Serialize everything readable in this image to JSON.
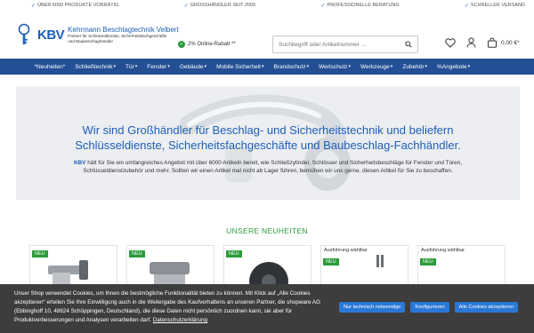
{
  "topbar": {
    "usps": [
      "ÜBER 6000 PRODUKTE VORRÄTIG",
      "GROSSHÄNDLER SEIT 2000",
      "PROFESSIONELLE BERATUNG",
      "SCHNELLER VERSAND"
    ]
  },
  "header": {
    "logo_mark": "KBV",
    "logo_title": "Kehrmann Beschlagtechnik Velbert",
    "logo_sub_line1": "Partner für Schlüsseldienste, Sicherheitsfachgeschäfte",
    "logo_sub_line2": "und Baubeschlaghändler",
    "rebate": "2% Online-Rabatt **",
    "search_placeholder": "Suchbegriff oder Artikelnummer ...",
    "cart_total": "0,00 €*"
  },
  "nav": {
    "items": [
      {
        "label": "*Neuheiten*",
        "chevron": false
      },
      {
        "label": "Schließtechnik",
        "chevron": true
      },
      {
        "label": "Tür",
        "chevron": true
      },
      {
        "label": "Fenster",
        "chevron": true
      },
      {
        "label": "Gebäude",
        "chevron": true
      },
      {
        "label": "Mobile Sicherheit",
        "chevron": true
      },
      {
        "label": "Brandschutz",
        "chevron": true
      },
      {
        "label": "Wertschutz",
        "chevron": true
      },
      {
        "label": "Werkzeuge",
        "chevron": true
      },
      {
        "label": "Zubehör",
        "chevron": true
      },
      {
        "label": "%Angebote",
        "chevron": true
      }
    ]
  },
  "hero": {
    "title_line1": "Wir sind Großhändler für Beschlag- und Sicherheitstechnik und beliefern",
    "title_line2": "Schlüsseldienste, Sicherheitsfachgeschäfte und Baubeschlag-Fachhändler.",
    "text_brand": "KBV",
    "text_line1": " hält für Sie ein umfangreiches Angebot mit über 6000 Artikeln bereit, wie Schließzylinder, Schlösser und Sicherheitsbeschläge für Fenster und Türen,",
    "text_line2": "Schlüsseldienstzubehör und mehr. Sollten wir einen Artikel mal nicht ab Lager führen, bemühen wir uns gerne, diesen Artikel für Sie zu beschaffen."
  },
  "news": {
    "title": "UNSERE NEUHEITEN",
    "cards": [
      {
        "badge": "NEU",
        "variant": ""
      },
      {
        "badge": "NEU",
        "variant": ""
      },
      {
        "badge": "NEU",
        "variant": ""
      },
      {
        "badge": "NEU",
        "variant": "Ausführung wählbar"
      },
      {
        "badge": "NEU",
        "variant": "Ausführung wählbar"
      }
    ]
  },
  "cookie": {
    "text": "Unser Shop verwendet Cookies, um Ihnen die bestmögliche Funktionalität bieten zu können. Mit Klick auf „Alle Cookies akzeptieren“ erteilen Sie Ihre Einwilligung auch in die Weitergabe des Kaufverhaltens an unseren Partner, die shopware AG (Ebbinghoff 10, 48624 Schöppingen, Deutschland), die diese Daten nicht persönlich zuordnen kann, sie aber für Produktverbesserungen und Analysen verarbeiten darf.",
    "link": "Datenschutzerklärung",
    "btn_necessary": "Nur technisch notwendige",
    "btn_configure": "Konfigurieren",
    "btn_accept": "Alle Cookies akzeptieren"
  },
  "colors": {
    "brand_blue": "#1d5fb8",
    "nav_bg": "#244f95",
    "green": "#2b9b3a",
    "cookie_bg": "#3d3d3d",
    "button_blue": "#2a78d6"
  }
}
